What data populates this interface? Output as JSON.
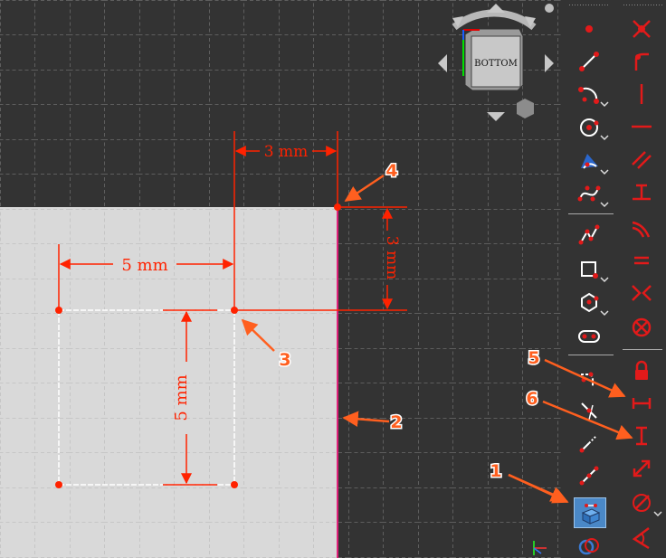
{
  "viewcube": {
    "face_label": "BOTTOM"
  },
  "dimensions": {
    "top_horizontal": "3 mm",
    "right_vertical": "3 mm",
    "rect_width": "5 mm",
    "rect_height": "5 mm"
  },
  "annotations": [
    "1",
    "2",
    "3",
    "4",
    "5",
    "6"
  ],
  "colors": {
    "background": "#333333",
    "solid_face": "#d9d9d9",
    "constraint": "#ff2200",
    "annotation": "#ff5f1f",
    "edge_magenta": "#e0207a",
    "sketch_line": "#ffffff"
  },
  "toolbar_left": {
    "items": [
      {
        "icon": "point-icon"
      },
      {
        "icon": "line-icon"
      },
      {
        "icon": "arc-icon"
      },
      {
        "icon": "circle-icon"
      },
      {
        "icon": "conic-icon"
      },
      {
        "icon": "bspline-icon"
      },
      {
        "icon": "polyline-icon"
      },
      {
        "icon": "rectangle-icon"
      },
      {
        "icon": "polygon-icon"
      },
      {
        "icon": "slot-icon"
      },
      {
        "icon": "fillet-icon"
      },
      {
        "icon": "trim-icon"
      },
      {
        "icon": "extend-icon"
      },
      {
        "icon": "split-icon"
      },
      {
        "icon": "external-geometry-icon"
      },
      {
        "icon": "carbon-copy-icon"
      }
    ]
  },
  "toolbar_right": {
    "items": [
      {
        "icon": "constrain-coincident-icon"
      },
      {
        "icon": "constrain-point-on-object-icon"
      },
      {
        "icon": "constrain-vertical-icon"
      },
      {
        "icon": "constrain-horizontal-icon"
      },
      {
        "icon": "constrain-parallel-icon"
      },
      {
        "icon": "constrain-perpendicular-icon"
      },
      {
        "icon": "constrain-tangent-icon"
      },
      {
        "icon": "constrain-equal-icon"
      },
      {
        "icon": "constrain-symmetric-icon"
      },
      {
        "icon": "constrain-block-icon"
      },
      {
        "icon": "constrain-lock-icon"
      },
      {
        "icon": "constrain-horizontal-distance-icon"
      },
      {
        "icon": "constrain-vertical-distance-icon"
      },
      {
        "icon": "constrain-distance-icon"
      },
      {
        "icon": "constrain-radius-icon"
      },
      {
        "icon": "constrain-angle-icon"
      }
    ]
  }
}
